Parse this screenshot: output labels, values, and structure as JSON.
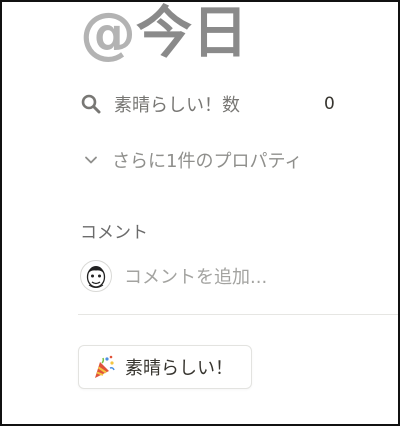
{
  "page": {
    "title_prefix": "@",
    "title_main": "今日"
  },
  "properties": {
    "stat": {
      "icon": "search-icon",
      "label": "素晴らしい！数",
      "value": "0"
    },
    "more": {
      "icon": "chevron-down-icon",
      "label": "さらに1件のプロパティ"
    }
  },
  "comments": {
    "heading": "コメント",
    "avatar_icon": "user-avatar",
    "placeholder": "コメントを追加..."
  },
  "reaction": {
    "icon": "party-popper-icon",
    "label": "素晴らしい！"
  },
  "colors": {
    "text_primary": "#37352f",
    "text_secondary": "#787774",
    "title_gray": "#b3b3b3",
    "border": "#e3e3e0"
  }
}
